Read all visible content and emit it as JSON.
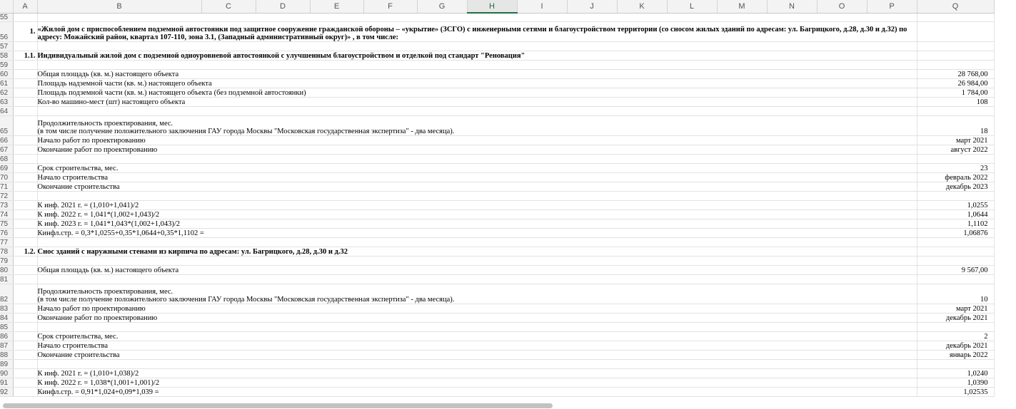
{
  "columns": [
    "A",
    "B",
    "C",
    "D",
    "E",
    "F",
    "G",
    "H",
    "I",
    "J",
    "K",
    "L",
    "M",
    "N",
    "O",
    "P",
    "Q"
  ],
  "selected_column": "H",
  "rows": [
    {
      "n": "55",
      "a": "",
      "b": "",
      "q": "",
      "h": 10
    },
    {
      "n": "56",
      "a": "1.",
      "b": "«Жилой дом с приспособлением подземной автостоянки под защитное сооружение гражданской обороны – «укрытие» (ЗСГО) с инженерными сетями и благоустройством территории (со сносом жилых зданий по адресам: ул. Багрицкого, д.28, д.30 и д.32) по",
      "b2": "адресу: Можайский район, квартал 107-110, зона 3.1, (Западный административный округ)» , в том числе:",
      "q": "",
      "h": 28,
      "bold": true
    },
    {
      "n": "57",
      "a": "",
      "b": "",
      "q": "",
      "h": 13
    },
    {
      "n": "58",
      "a": "1.1.",
      "b": "Индивидуальный жилой дом с подземной одноуровневой автостоянкой с улучшенным благоустройством и отделкой под стандарт \"Реновация\"",
      "q": "",
      "h": 13,
      "bold": true
    },
    {
      "n": "59",
      "a": "",
      "b": "",
      "q": "",
      "h": 13
    },
    {
      "n": "60",
      "a": "",
      "b": "Общая площадь (кв. м.) настоящего объекта",
      "q": "28 768,00",
      "h": 13
    },
    {
      "n": "61",
      "a": "",
      "b": "Площадь надземной части (кв. м.) настоящего объекта",
      "q": "26 984,00",
      "h": 13
    },
    {
      "n": "62",
      "a": "",
      "b": "Площадь подземной части (кв. м.) настоящего объекта (без подземной автостоянки)",
      "q": "1 784,00",
      "h": 13
    },
    {
      "n": "63",
      "a": "",
      "b": "Кол-во машино-мест (шт) настоящего объекта",
      "q": "108",
      "h": 13
    },
    {
      "n": "64",
      "a": "",
      "b": "",
      "q": "",
      "h": 13
    },
    {
      "n": "65",
      "a": "",
      "b": "Продолжительность проектирования, мес.",
      "b2": "(в том числе получение положительного заключения ГАУ города Москвы \"Московская государственная экспертиза\" - два месяца).",
      "q": "18",
      "h": 28
    },
    {
      "n": "66",
      "a": "",
      "b": "Начало работ по проектированию",
      "q": "март 2021",
      "h": 13
    },
    {
      "n": "67",
      "a": "",
      "b": "Окончание работ по проектированию",
      "q": "август 2022",
      "h": 13
    },
    {
      "n": "68",
      "a": "",
      "b": "",
      "q": "",
      "h": 13
    },
    {
      "n": "69",
      "a": "",
      "b": "Срок строительства, мес.",
      "q": "23",
      "h": 13
    },
    {
      "n": "70",
      "a": "",
      "b": "Начало строительства",
      "q": "февраль 2022",
      "h": 13
    },
    {
      "n": "71",
      "a": "",
      "b": "Окончание строительства",
      "q": "декабрь 2023",
      "h": 13
    },
    {
      "n": "72",
      "a": "",
      "b": "",
      "q": "",
      "h": 13
    },
    {
      "n": "73",
      "a": "",
      "b": "К инф. 2021 г. = (1,010+1,041)/2",
      "q": "1,0255",
      "h": 13
    },
    {
      "n": "74",
      "a": "",
      "b": "К инф. 2022 г. = 1,041*(1,002+1,043)/2",
      "q": "1,0644",
      "h": 13
    },
    {
      "n": "75",
      "a": "",
      "b": "К инф. 2023 г. = 1,041*1,043*(1,002+1,043)/2",
      "q": "1,1102",
      "h": 13
    },
    {
      "n": "76",
      "a": "",
      "b": "Кинфл.стр. = 0,3*1,0255+0,35*1,0644+0,35*1,1102 =",
      "q": "1,06876",
      "h": 13
    },
    {
      "n": "77",
      "a": "",
      "b": "",
      "q": "",
      "h": 13
    },
    {
      "n": "78",
      "a": "1.2.",
      "b": "Снос зданий с наружными стенами из кирпича по адресам: ул. Багрицкого, д.28, д.30 и д.32",
      "q": "",
      "h": 13,
      "bold": true
    },
    {
      "n": "79",
      "a": "",
      "b": "",
      "q": "",
      "h": 13
    },
    {
      "n": "80",
      "a": "",
      "b": "Общая площадь (кв. м.) настоящего объекта",
      "q": "9 567,00",
      "h": 13
    },
    {
      "n": "81",
      "a": "",
      "b": "",
      "q": "",
      "h": 13
    },
    {
      "n": "82",
      "a": "",
      "b": "Продолжительность проектирования, мес.",
      "b2": "(в том числе получение положительного заключения ГАУ города Москвы \"Московская государственная экспертиза\" - два месяца).",
      "q": "10",
      "h": 28
    },
    {
      "n": "83",
      "a": "",
      "b": "Начало работ по проектированию",
      "q": "март 2021",
      "h": 13
    },
    {
      "n": "84",
      "a": "",
      "b": "Окончание работ по проектированию",
      "q": "декабрь 2021",
      "h": 13
    },
    {
      "n": "85",
      "a": "",
      "b": "",
      "q": "",
      "h": 13
    },
    {
      "n": "86",
      "a": "",
      "b": "Срок строительства, мес.",
      "q": "2",
      "h": 13
    },
    {
      "n": "87",
      "a": "",
      "b": "Начало строительства",
      "q": "декабрь 2021",
      "h": 13
    },
    {
      "n": "88",
      "a": "",
      "b": "Окончание строительства",
      "q": "январь 2022",
      "h": 13
    },
    {
      "n": "89",
      "a": "",
      "b": "",
      "q": "",
      "h": 13
    },
    {
      "n": "90",
      "a": "",
      "b": "К инф. 2021 г. = (1,010+1,038)/2",
      "q": "1,0240",
      "h": 13
    },
    {
      "n": "91",
      "a": "",
      "b": "К инф. 2022 г. = 1,038*(1,001+1,001)/2",
      "q": "1,0390",
      "h": 13
    },
    {
      "n": "92",
      "a": "",
      "b": "Кинфл.стр. = 0,91*1,024+0,09*1,039 =",
      "q": "1,02535",
      "h": 13
    }
  ]
}
